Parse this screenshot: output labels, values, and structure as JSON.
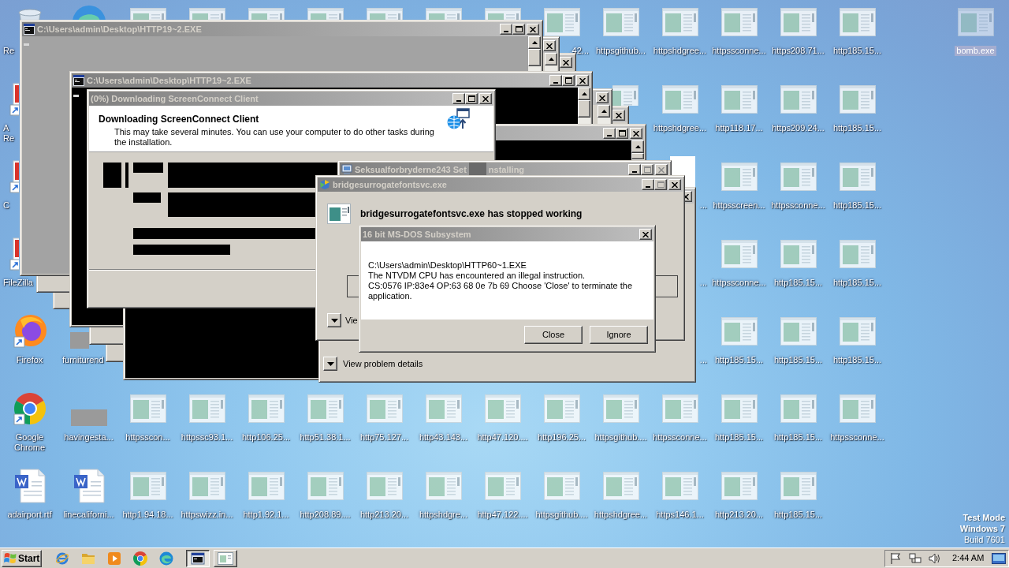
{
  "desktop": {
    "icon_rows": [
      [
        {
          "kind": "recycle-bin",
          "label": "Re",
          "clip_right": true,
          "icon_clipped": true,
          "selected": false
        },
        {
          "kind": "edge",
          "icon_clipped": true,
          "selected": false
        },
        {
          "kind": "exe",
          "icon_clipped": true,
          "selected": false
        },
        {
          "kind": "exe",
          "icon_clipped": true,
          "selected": false
        },
        {
          "kind": "exe",
          "icon_clipped": true,
          "selected": false
        },
        {
          "kind": "exe",
          "icon_clipped": true,
          "selected": false
        },
        {
          "kind": "exe",
          "icon_clipped": true,
          "selected": false
        },
        {
          "kind": "exe",
          "icon_clipped": true,
          "selected": false
        },
        {
          "kind": "exe",
          "icon_clipped": true,
          "selected": false
        },
        {
          "kind": "exe",
          "label": ".42...",
          "clip_left": true,
          "selected": false
        },
        {
          "kind": "exe",
          "label": "httpsgithub...",
          "selected": false
        },
        {
          "kind": "exe",
          "label": "httpshdgree...",
          "selected": false
        },
        {
          "kind": "exe",
          "label": "httpssconne...",
          "selected": false
        },
        {
          "kind": "exe",
          "label": "https208.71...",
          "selected": false
        },
        {
          "kind": "exe",
          "label": "http185.15...",
          "selected": false
        },
        null,
        {
          "kind": "exe",
          "label": "bomb.exe",
          "selected": true
        }
      ],
      [
        {
          "kind": "shortcut",
          "label": "A\nRe",
          "clip_right": true,
          "icon_clipped": true,
          "selected": false
        },
        null,
        null,
        null,
        null,
        null,
        null,
        null,
        null,
        null,
        {
          "kind": "exe",
          "icon_clipped": true,
          "selected": false
        },
        {
          "kind": "exe",
          "label": "httpshdgree...",
          "selected": false
        },
        {
          "kind": "exe",
          "label": "http118.17...",
          "selected": false
        },
        {
          "kind": "exe",
          "label": "https209.24...",
          "selected": false
        },
        {
          "kind": "exe",
          "label": "http185.15...",
          "selected": false
        }
      ],
      [
        {
          "kind": "shortcut",
          "label": "C",
          "clip_right": true,
          "icon_clipped": true,
          "selected": false
        },
        null,
        null,
        null,
        null,
        null,
        null,
        null,
        null,
        null,
        null,
        {
          "kind": "label",
          "label": "...",
          "clip_left": true,
          "selected": false
        },
        {
          "kind": "exe",
          "label": "httpsscreen...",
          "selected": false
        },
        {
          "kind": "exe",
          "label": "httpssconne...",
          "selected": false
        },
        {
          "kind": "exe",
          "label": "http185.15...",
          "selected": false
        }
      ],
      [
        {
          "kind": "shortcut",
          "label": "FileZilla",
          "clip_right": true,
          "icon_clipped": true,
          "selected": false
        },
        null,
        null,
        null,
        null,
        null,
        null,
        null,
        null,
        null,
        null,
        {
          "kind": "label",
          "label": "...",
          "clip_left": true,
          "selected": false
        },
        {
          "kind": "exe",
          "label": "httpssconne...",
          "selected": false
        },
        {
          "kind": "exe",
          "label": "http185.15...",
          "selected": false
        },
        {
          "kind": "exe",
          "label": "http185.15...",
          "selected": false
        }
      ],
      [
        {
          "kind": "firefox",
          "label": "Firefox",
          "selected": false
        },
        {
          "kind": "thumbnail",
          "label": "furniturend",
          "clip_right": true,
          "icon_clipped": true,
          "selected": false
        },
        null,
        null,
        null,
        null,
        null,
        null,
        null,
        null,
        null,
        {
          "kind": "label",
          "label": "...",
          "clip_left": true,
          "selected": false
        },
        {
          "kind": "exe",
          "label": "http185.15...",
          "selected": false
        },
        {
          "kind": "exe",
          "label": "http185.15...",
          "selected": false
        },
        {
          "kind": "exe",
          "label": "http185.15...",
          "selected": false
        }
      ],
      [
        {
          "kind": "chrome",
          "label": "Google\nChrome",
          "selected": false
        },
        {
          "kind": "thumbnail",
          "label": "havingesta...",
          "selected": false
        },
        {
          "kind": "exe",
          "label": "httpsscon...",
          "selected": false
        },
        {
          "kind": "exe",
          "label": "httpssc93.1...",
          "selected": false
        },
        {
          "kind": "exe",
          "label": "http106.25...",
          "selected": false
        },
        {
          "kind": "exe",
          "label": "http51.38.1...",
          "selected": false
        },
        {
          "kind": "exe",
          "label": "http75.127...",
          "selected": false
        },
        {
          "kind": "exe",
          "label": "http43.143...",
          "selected": false
        },
        {
          "kind": "exe",
          "label": "http47.120....",
          "selected": false
        },
        {
          "kind": "exe",
          "label": "http196.25...",
          "selected": false
        },
        {
          "kind": "exe",
          "label": "httpsgithub....",
          "selected": false
        },
        {
          "kind": "exe",
          "label": "httpssconne...",
          "selected": false
        },
        {
          "kind": "exe",
          "label": "http185.15...",
          "selected": false
        },
        {
          "kind": "exe",
          "label": "http185.15...",
          "selected": false
        },
        {
          "kind": "exe",
          "label": "httpssconne...",
          "selected": false
        }
      ],
      [
        {
          "kind": "word",
          "label": "adairport.rtf",
          "selected": false
        },
        {
          "kind": "word",
          "label": "linecaliforni...",
          "selected": false
        },
        {
          "kind": "exe",
          "label": "http1.94.18...",
          "selected": false
        },
        {
          "kind": "exe",
          "label": "httpswizz.in...",
          "selected": false
        },
        {
          "kind": "exe",
          "label": "http1.92.1...",
          "selected": false
        },
        {
          "kind": "exe",
          "label": "http208.89....",
          "selected": false
        },
        {
          "kind": "exe",
          "label": "http213.20...",
          "selected": false
        },
        {
          "kind": "exe",
          "label": "httpshdgre...",
          "selected": false
        },
        {
          "kind": "exe",
          "label": "http47.122....",
          "selected": false
        },
        {
          "kind": "exe",
          "label": "httpsgithub....",
          "selected": false
        },
        {
          "kind": "exe",
          "label": "httpshdgree...",
          "selected": false
        },
        {
          "kind": "exe",
          "label": "https146.1...",
          "selected": false
        },
        {
          "kind": "exe",
          "label": "http213.20...",
          "selected": false
        },
        {
          "kind": "exe",
          "label": "http185.15...",
          "selected": false
        }
      ]
    ]
  },
  "console_windows": [
    {
      "kind": "console",
      "title": "C:\\Users\\admin\\Desktop\\HTTP19~2.EXE",
      "dimmed": true,
      "cursor": true,
      "title_buttons": [
        {
          "kind": "minimize",
          "disabled": false
        },
        {
          "kind": "maximize",
          "disabled": false
        },
        {
          "kind": "close",
          "disabled": false
        }
      ]
    },
    {
      "kind": "fragment",
      "title_buttons": [
        {
          "kind": "close",
          "disabled": false
        }
      ]
    },
    {
      "kind": "fragment",
      "title_buttons": [
        {
          "kind": "close",
          "disabled": false
        }
      ]
    },
    {
      "kind": "console",
      "title": "C:\\Users\\admin\\Desktop\\HTTP19~2.EXE",
      "dimmed": false,
      "cursor": true,
      "title_buttons": [
        {
          "kind": "minimize",
          "disabled": false
        },
        {
          "kind": "maximize",
          "disabled": false
        },
        {
          "kind": "close",
          "disabled": false
        }
      ]
    },
    {
      "kind": "fragment",
      "title_buttons": [
        {
          "kind": "close",
          "disabled": false
        }
      ]
    },
    {
      "kind": "fragment",
      "title_buttons": [
        {
          "kind": "close",
          "disabled": false
        }
      ]
    },
    {
      "kind": "console",
      "dimmed": false,
      "title_buttons": [
        {
          "kind": "minimize",
          "disabled": false
        },
        {
          "kind": "maximize",
          "disabled": false
        },
        {
          "kind": "close",
          "disabled": false
        }
      ]
    }
  ],
  "download_window": {
    "title": "(0%) Downloading ScreenConnect Client",
    "heading": "Downloading ScreenConnect Client",
    "description": "This may take several minutes. You can use your computer to do other tasks during the installation.",
    "title_buttons": [
      {
        "kind": "minimize",
        "disabled": false
      },
      {
        "kind": "maximize",
        "disabled": false
      },
      {
        "kind": "close",
        "disabled": false
      }
    ]
  },
  "setup_window": {
    "title_fragments": [
      "Seksualforbryderne243 Set",
      "nstalling"
    ],
    "title_buttons": [
      {
        "kind": "minimize",
        "disabled": false
      },
      {
        "kind": "maximize",
        "disabled": true
      },
      {
        "kind": "close",
        "disabled": true
      }
    ]
  },
  "error_dialog_back": {
    "details_label": "View problem details",
    "title_buttons": [
      {
        "kind": "close",
        "disabled": false
      }
    ]
  },
  "error_dialog": {
    "title": "bridgesurrogatefontsvc.exe",
    "heading": "bridgesurrogatefontsvc.exe has stopped working",
    "details_label": "Vie",
    "title_buttons": [
      {
        "kind": "minimize",
        "disabled": false
      },
      {
        "kind": "maximize",
        "disabled": true
      },
      {
        "kind": "close",
        "disabled": false
      }
    ]
  },
  "dos_dialog": {
    "title": "16 bit MS-DOS Subsystem",
    "message_lines": [
      "C:\\Users\\admin\\Desktop\\HTTP60~1.EXE",
      "The NTVDM CPU has encountered an illegal instruction.",
      "CS:0576 IP:83e4 OP:63 68 0e 7b 69 Choose 'Close' to terminate the application."
    ],
    "buttons": [
      "Close",
      "Ignore"
    ],
    "title_buttons": [
      {
        "kind": "close",
        "disabled": false
      }
    ]
  },
  "os_notice": [
    {
      "text": "Test Mode",
      "bold": true
    },
    {
      "text": "Windows 7",
      "bold": true
    },
    {
      "text": "Build 7601",
      "bold": false
    }
  ],
  "taskbar": {
    "start_label": "Start",
    "quick_launch": [
      {
        "kind": "ie"
      },
      {
        "kind": "folder"
      },
      {
        "kind": "media"
      },
      {
        "kind": "chrome"
      },
      {
        "kind": "edge"
      }
    ],
    "tasks": [
      {
        "kind": "console",
        "selected": true
      },
      {
        "kind": "window",
        "selected": false
      }
    ],
    "clock": "2:44 AM"
  }
}
